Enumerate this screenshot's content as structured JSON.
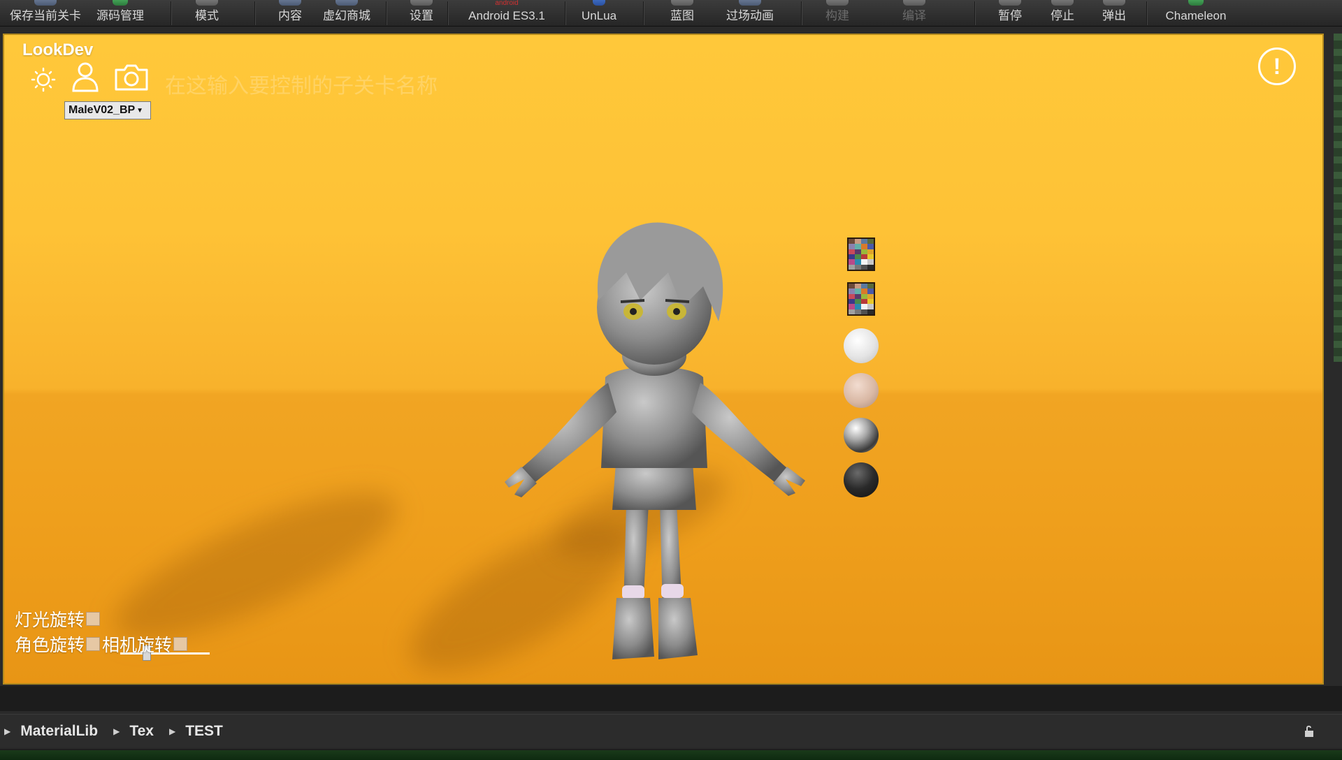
{
  "toolbar": {
    "items": [
      {
        "label": "保存当前关卡"
      },
      {
        "label": "源码管理"
      },
      {
        "label": "模式"
      },
      {
        "label": "内容"
      },
      {
        "label": "虚幻商城"
      },
      {
        "label": "设置"
      },
      {
        "label": "Android ES3.1",
        "badge": "android"
      },
      {
        "label": "UnLua"
      },
      {
        "label": "蓝图"
      },
      {
        "label": "过场动画"
      },
      {
        "label": "构建"
      },
      {
        "label": "编译"
      },
      {
        "label": "暂停"
      },
      {
        "label": "停止"
      },
      {
        "label": "弹出"
      },
      {
        "label": "Chameleon"
      }
    ]
  },
  "lookdev": {
    "title": "LookDev",
    "character_select": "MaleV02_BP",
    "faint_hint": "在这输入要控制的子关卡名称",
    "warning_symbol": "!",
    "controls": {
      "light_rotate": "灯光旋转",
      "character_rotate": "角色旋转",
      "camera_rotate": "相机旋转",
      "light_rotate_slider": 0.3
    }
  },
  "breadcrumb": [
    "MaterialLib",
    "Tex",
    "TEST"
  ],
  "colors": {
    "viewport_sky": "#ffc83a",
    "viewport_floor": "#ef9f1c",
    "toolbar_bg": "#2e2e2e"
  }
}
